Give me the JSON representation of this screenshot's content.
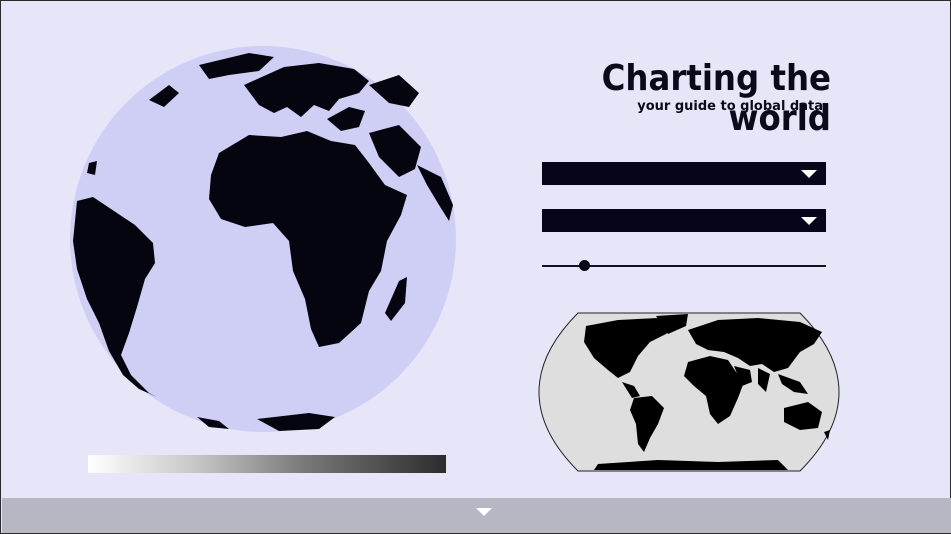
{
  "header": {
    "title": "Charting the world",
    "subtitle": "your guide to global data"
  },
  "controls": {
    "dropdown_1": {
      "selected": "",
      "icon": "chevron-down-icon"
    },
    "dropdown_2": {
      "selected": "",
      "icon": "chevron-down-icon"
    },
    "slider": {
      "value_fraction": 0.15
    }
  },
  "globe": {
    "ocean_color": "#cfcef5",
    "land_color": "#05050f"
  },
  "minimap": {
    "ocean_color": "#dedede",
    "land_color": "#000000"
  },
  "legend": {
    "gradient_from": "#ffffff",
    "gradient_to": "#2c2c2c"
  },
  "footer": {
    "toggle_icon": "chevron-down-icon",
    "bar_color": "#b7b7c4"
  }
}
